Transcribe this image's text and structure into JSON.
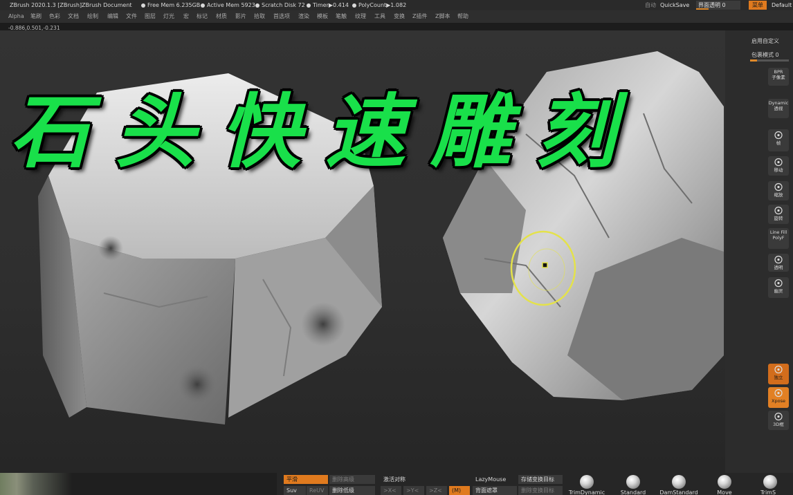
{
  "titlebar": {
    "app": "ZBrush 2020.1.3 [ZBrush]",
    "document": "ZBrush Document",
    "free_mem": "Free Mem 6.235GB",
    "active_mem": "Active Mem 5923",
    "scratch": "Scratch Disk 72",
    "timer": "Timer▶0.414",
    "polycount": "PolyCount▶1.082",
    "auto": "自动",
    "quicksave": "QuickSave",
    "transparency": "界面透明 0",
    "menu": "菜单",
    "default": "Default"
  },
  "menus": [
    "Alpha",
    "笔刷",
    "色彩",
    "文档",
    "绘制",
    "编辑",
    "文件",
    "图层",
    "灯光",
    "宏",
    "标记",
    "材质",
    "影片",
    "拾取",
    "首选项",
    "渲染",
    "模板",
    "笔触",
    "纹理",
    "工具",
    "变换",
    "Z插件",
    "Z脚本",
    "帮助"
  ],
  "coords": "-0.886,0.501,-0.231",
  "headline": "石头快速雕刻",
  "right_shelf": {
    "custom_label": "启用自定义",
    "wrap_label": "包裹模式 0",
    "buttons": [
      {
        "icon": "bpr-icon",
        "top": "BPR",
        "bottom": "子像素"
      },
      {
        "icon": "dynamic-icon",
        "top": "Dynamic",
        "bottom": "透视"
      },
      {
        "icon": "frame-icon",
        "top": "",
        "bottom": "帧"
      },
      {
        "icon": "move-icon",
        "top": "",
        "bottom": "移动"
      },
      {
        "icon": "scale-icon",
        "top": "",
        "bottom": "缩放"
      },
      {
        "icon": "rotate-icon",
        "top": "",
        "bottom": "旋转"
      },
      {
        "icon": "linefill-icon",
        "top": "Line Fill",
        "bottom": "PolyF"
      },
      {
        "icon": "transp-icon",
        "top": "",
        "bottom": "透明"
      },
      {
        "icon": "ghost-icon",
        "top": "",
        "bottom": "幽灵"
      },
      {
        "icon": "solo-icon",
        "top": "",
        "bottom": "独立"
      },
      {
        "icon": "xpose-icon",
        "top": "",
        "bottom": "Xpose"
      },
      {
        "icon": "frame3d-icon",
        "top": "",
        "bottom": "3D框"
      }
    ]
  },
  "bottom": {
    "smooth": "平滑",
    "delete_high": "删除高级",
    "suv": "Suv",
    "reuv": "ReUV",
    "delete_low": "删除低级",
    "activate_sym": "激活对称",
    "sym_x": ">X<",
    "sym_y": ">Y<",
    "sym_z": ">Z<",
    "sym_m": "(M)",
    "lazymouse": "LazyMouse",
    "backface": "背面遮罩",
    "store_morph": "存储变换目标",
    "delete_morph": "删除变换目标",
    "brushes": [
      "TrimDynamic",
      "Standard",
      "DamStandard",
      "Move",
      "TrimS"
    ]
  },
  "colors": {
    "accent": "#e07a1e",
    "headline": "#19e04a",
    "brush_ring": "#e4e24a"
  }
}
